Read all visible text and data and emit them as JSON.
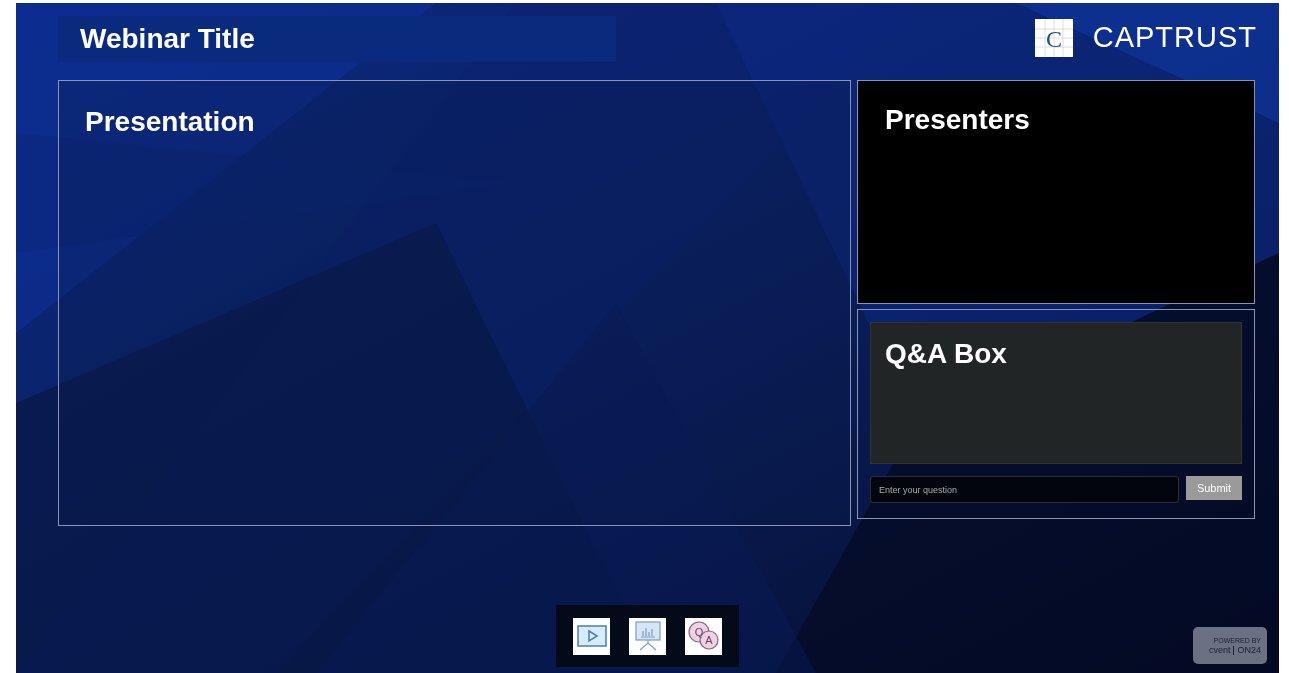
{
  "header": {
    "title": "Webinar Title",
    "logo": {
      "mark": "C",
      "text": "CAPTRUST"
    }
  },
  "presentation": {
    "title": "Presentation"
  },
  "presenters": {
    "title": "Presenters"
  },
  "qa": {
    "title": "Q&A Box",
    "input": {
      "placeholder": "Enter your question"
    },
    "submit": "Submit"
  },
  "dock": [
    {
      "kind": "video"
    },
    {
      "kind": "slides"
    },
    {
      "kind": "qa",
      "letters": [
        "Q",
        "A"
      ]
    }
  ],
  "badge": {
    "caption": "POWERED BY",
    "brands": [
      "cvent",
      "ON24"
    ]
  }
}
